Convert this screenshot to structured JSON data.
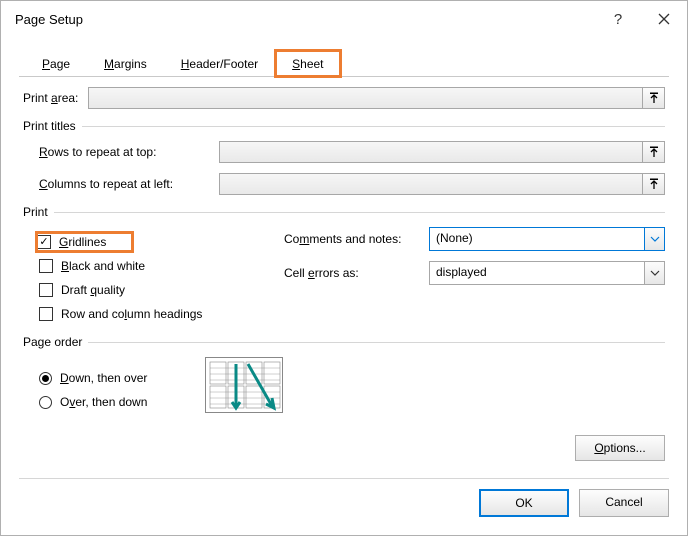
{
  "window": {
    "title": "Page Setup"
  },
  "tabs": {
    "page": "Page",
    "margins": "Margins",
    "header_footer": "Header/Footer",
    "sheet": "Sheet",
    "active": "sheet"
  },
  "print_area": {
    "label": "Print area:",
    "value": ""
  },
  "print_titles": {
    "legend": "Print titles",
    "rows_label": "Rows to repeat at top:",
    "rows_value": "",
    "cols_label": "Columns to repeat at left:",
    "cols_value": ""
  },
  "print": {
    "legend": "Print",
    "gridlines": {
      "label": "Gridlines",
      "checked": true
    },
    "black_white": {
      "label": "Black and white",
      "checked": false
    },
    "draft": {
      "label": "Draft quality",
      "checked": false
    },
    "row_col_headings": {
      "label": "Row and column headings",
      "checked": false
    },
    "comments_label": "Comments and notes:",
    "comments_value": "(None)",
    "errors_label": "Cell errors as:",
    "errors_value": "displayed"
  },
  "page_order": {
    "legend": "Page order",
    "down_over": {
      "label": "Down, then over",
      "selected": true
    },
    "over_down": {
      "label": "Over, then down",
      "selected": false
    }
  },
  "buttons": {
    "options": "Options...",
    "ok": "OK",
    "cancel": "Cancel"
  }
}
